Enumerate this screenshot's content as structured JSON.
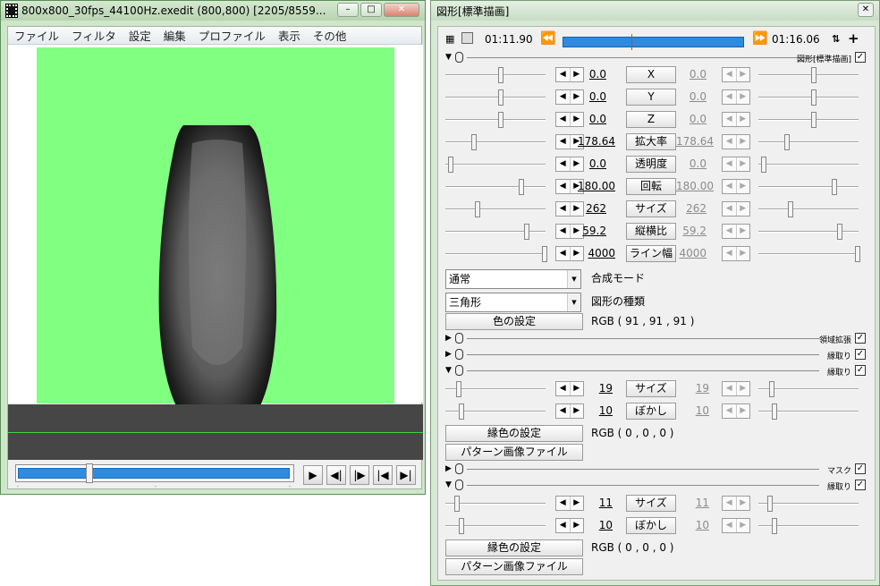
{
  "main_window": {
    "title": "800x800_30fps_44100Hz.exedit (800,800)  [2205/8559...",
    "menu": [
      "ファイル",
      "フィルタ",
      "設定",
      "編集",
      "プロファイル",
      "表示",
      "その他"
    ],
    "background_color": "#80ff80",
    "seek_progress": 0.26
  },
  "object_window": {
    "title": "図形[標準描画]",
    "time_start": "01:11.90",
    "time_end": "01:16.06",
    "section_label": "図形[標準描画]",
    "params": [
      {
        "name": "X",
        "start": "0.0",
        "end": "0.0"
      },
      {
        "name": "Y",
        "start": "0.0",
        "end": "0.0"
      },
      {
        "name": "Z",
        "start": "0.0",
        "end": "0.0"
      },
      {
        "name": "拡大率",
        "start": "178.64",
        "end": "178.64"
      },
      {
        "name": "透明度",
        "start": "0.0",
        "end": "0.0"
      },
      {
        "name": "回転",
        "start": "180.00",
        "end": "180.00"
      },
      {
        "name": "サイズ",
        "start": "262",
        "end": "262"
      },
      {
        "name": "縦横比",
        "start": "59.2",
        "end": "59.2"
      },
      {
        "name": "ライン幅",
        "start": "4000",
        "end": "4000"
      }
    ],
    "blend_mode": {
      "value": "通常",
      "label": "合成モード"
    },
    "shape_type": {
      "value": "三角形",
      "label": "図形の種類"
    },
    "color_button": "色の設定",
    "color_value": "RGB ( 91 , 91 , 91 )",
    "filters": [
      {
        "name": "領域拡張",
        "checked": true
      },
      {
        "name": "縁取り",
        "checked": true
      },
      {
        "name": "縁取り",
        "checked": true,
        "params": [
          {
            "name": "サイズ",
            "start": "19",
            "end": "19"
          },
          {
            "name": "ぼかし",
            "start": "10",
            "end": "10"
          }
        ],
        "color_button": "縁色の設定",
        "color_value": "RGB ( 0 , 0 , 0 )",
        "pattern_button": "パターン画像ファイル"
      },
      {
        "name": "マスク",
        "checked": true
      },
      {
        "name": "縁取り",
        "checked": true,
        "params": [
          {
            "name": "サイズ",
            "start": "11",
            "end": "11"
          },
          {
            "name": "ぼかし",
            "start": "10",
            "end": "10"
          }
        ],
        "color_button": "縁色の設定",
        "color_value": "RGB ( 0 , 0 , 0 )",
        "pattern_button": "パターン画像ファイル"
      }
    ]
  }
}
